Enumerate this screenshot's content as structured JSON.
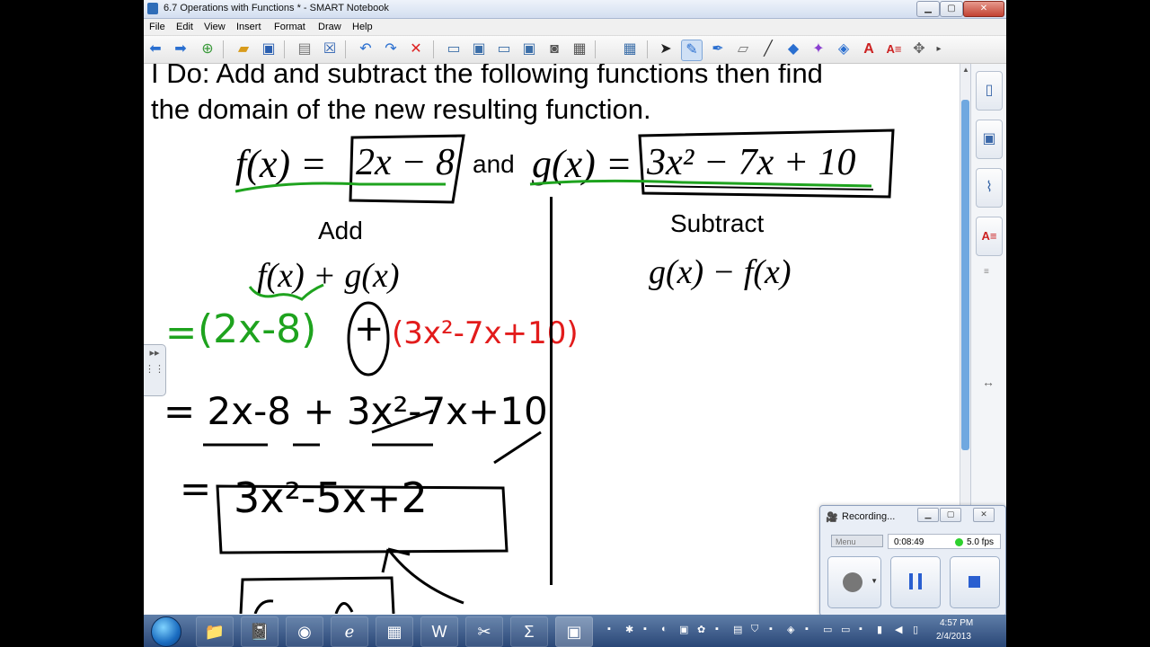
{
  "window": {
    "title": "6.7  Operations with Functions * - SMART Notebook",
    "min_label": "▁",
    "max_label": "▢",
    "close_label": "✕"
  },
  "menu": [
    "File",
    "Edit",
    "View",
    "Insert",
    "Format",
    "Draw",
    "Help"
  ],
  "toolbar_icons": [
    "back-arrow-icon",
    "forward-arrow-icon",
    "add-page-icon",
    "open-folder-icon",
    "save-icon",
    "paste-icon",
    "delete-page-icon",
    "undo-icon",
    "redo-icon",
    "delete-icon",
    "screen-shade-icon",
    "full-screen-icon",
    "dual-display-icon",
    "capture-icon",
    "camera-icon",
    "table-icon",
    "select-arrow-icon",
    "pen-icon",
    "creative-pen-icon",
    "eraser-icon",
    "line-icon",
    "shape-icon",
    "magic-pen-icon",
    "fill-icon",
    "text-icon",
    "properties-icon",
    "move-toolbar-icon"
  ],
  "lesson": {
    "prompt_line1": "I Do:  Add and subtract the following functions then find",
    "prompt_line2": "the domain of the new resulting function.",
    "f_def": "f(x) = 2x − 8",
    "f_left": "f(x) =",
    "f_right": "2x − 8",
    "and_word": "and",
    "g_left": "g(x) =",
    "g_right": "3x² − 7x + 10",
    "add_heading": "Add",
    "add_expr": "f(x) + g(x)",
    "subtract_heading": "Subtract",
    "subtract_expr": "g(x) − f(x)"
  },
  "handwriting": {
    "step1_eq": "=",
    "step1_green": "(2x-8)",
    "step1_plus": "+",
    "step1_red": "(3x²-7x+10)",
    "step2": "= 2x-8 + 3x²-7x+10",
    "step3_eq": "=",
    "step3_boxed": "3x²-5x+2",
    "ink_colors": {
      "green": "#1ea31e",
      "red": "#e21b1b",
      "black": "#000000"
    }
  },
  "sidebar_tabs": [
    "page-sorter-icon",
    "gallery-icon",
    "attachments-icon",
    "properties-icon"
  ],
  "recorder": {
    "title": "Recording...",
    "menu_label": "Menu",
    "elapsed": "0:08:49",
    "fps": "5.0 fps"
  },
  "taskbar": {
    "apps": [
      "explorer-icon",
      "notebook-icon",
      "chrome-icon",
      "ie-icon",
      "calculator-icon",
      "word-icon",
      "snipping-icon",
      "sigma-icon",
      "recorder-app-icon"
    ],
    "time": "4:57 PM",
    "date": "2/4/2013"
  }
}
